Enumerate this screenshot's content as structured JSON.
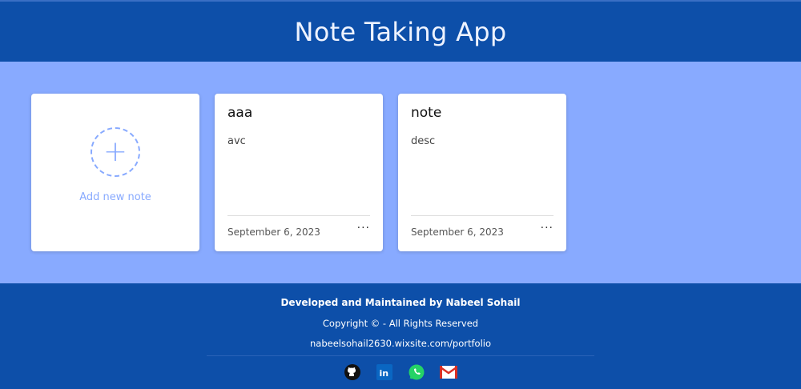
{
  "header": {
    "title": "Note Taking App"
  },
  "add_card": {
    "label": "Add new note",
    "icon": "plus-icon"
  },
  "notes": [
    {
      "title": "aaa",
      "description": "avc",
      "date": "September 6, 2023",
      "menu": "···"
    },
    {
      "title": "note",
      "description": "desc",
      "date": "September 6, 2023",
      "menu": "···"
    }
  ],
  "footer": {
    "developer": "Developed and Maintained by Nabeel Sohail",
    "copyright": "Copyright © - All Rights Reserved",
    "link": "nabeelsohail2630.wixsite.com/portfolio",
    "icons": [
      "github-icon",
      "linkedin-icon",
      "whatsapp-icon",
      "gmail-icon"
    ]
  },
  "colors": {
    "header_bg": "#0d4fa9",
    "main_bg": "#88aaff",
    "accent": "#88aaff"
  }
}
